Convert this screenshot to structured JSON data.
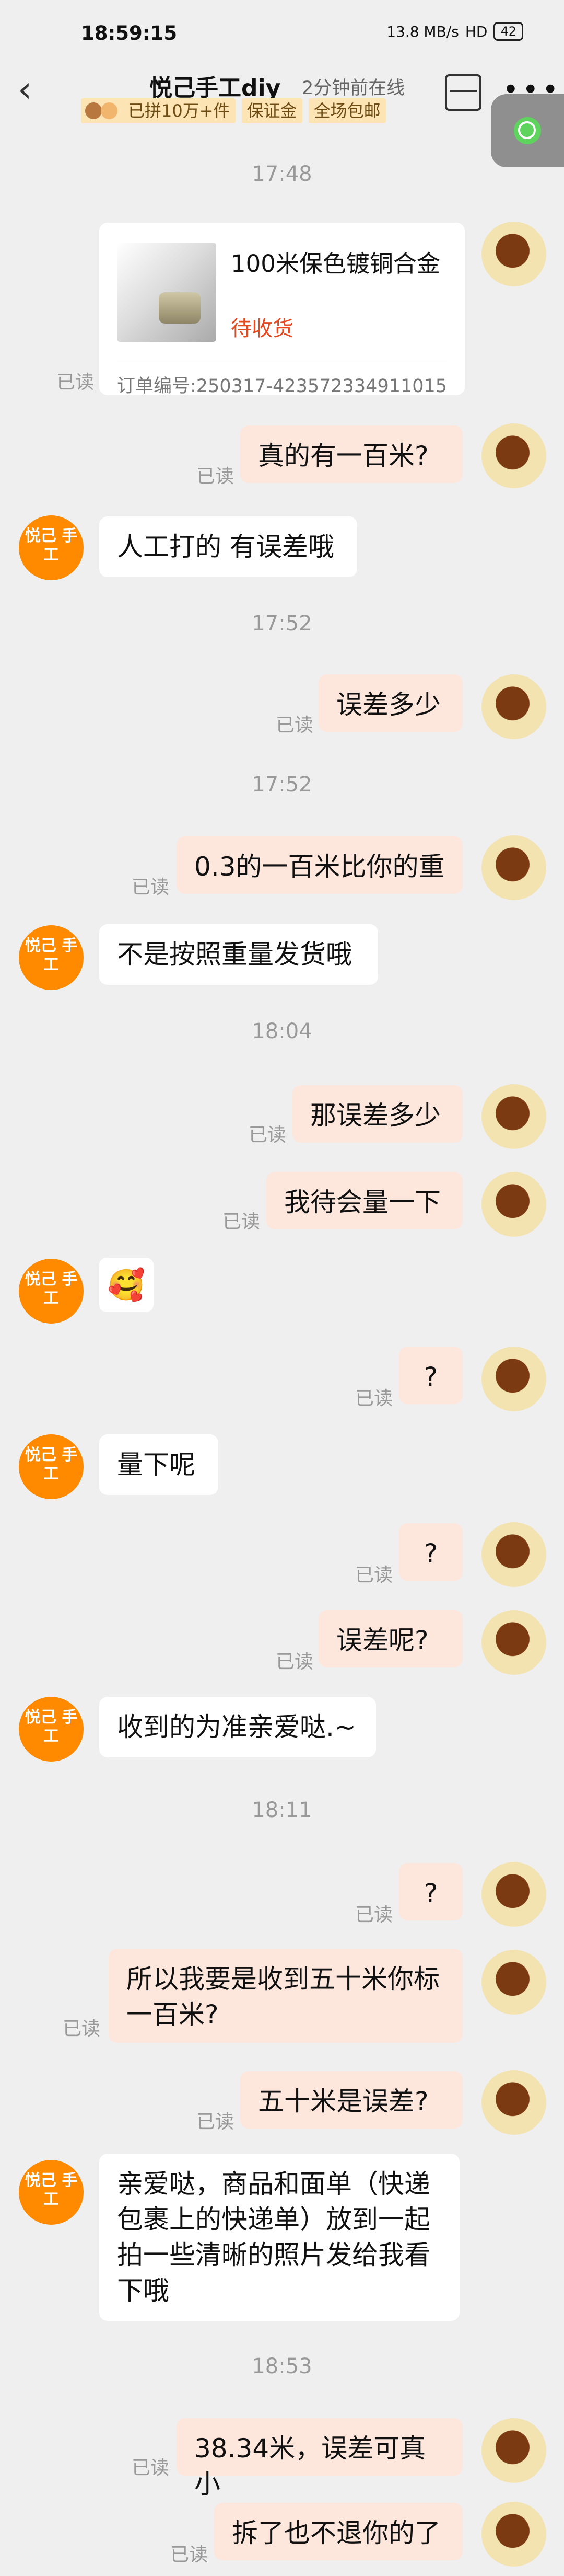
{
  "status_bar": {
    "time": "18:59:15",
    "network": "13.8 MB/s",
    "signal": "HD",
    "battery": "42"
  },
  "header": {
    "title": "悦己手工diy",
    "online": "2分钟前在线",
    "badges": [
      "已拼10万+件",
      "保证金",
      "全场包邮"
    ]
  },
  "product": {
    "name": "100米保色镀铜合金",
    "status": "待收货",
    "order": "订单编号:250317-423572334911015"
  },
  "timestamps": [
    "17:48",
    "17:52",
    "17:52",
    "18:04",
    "18:11",
    "18:53"
  ],
  "read": "已读",
  "shop_avatar": "悦己 手工",
  "messages": [
    "真的有一百米?",
    "人工打的 有误差哦",
    "误差多少",
    "0.3的一百米比你的重",
    "不是按照重量发货哦",
    "那误差多少",
    "我待会量一下",
    "?",
    "量下呢",
    "?",
    "误差呢?",
    "收到的为准亲爱哒.~",
    "?",
    "所以我要是收到五十米你标一百米?",
    "五十米是误差?",
    "亲爱哒，商品和面单（快递包裹上的快递单）放到一起拍一些清晰的照片发给我看下哦",
    "38.34米，误差可真小",
    "拆了也不退你的了"
  ]
}
